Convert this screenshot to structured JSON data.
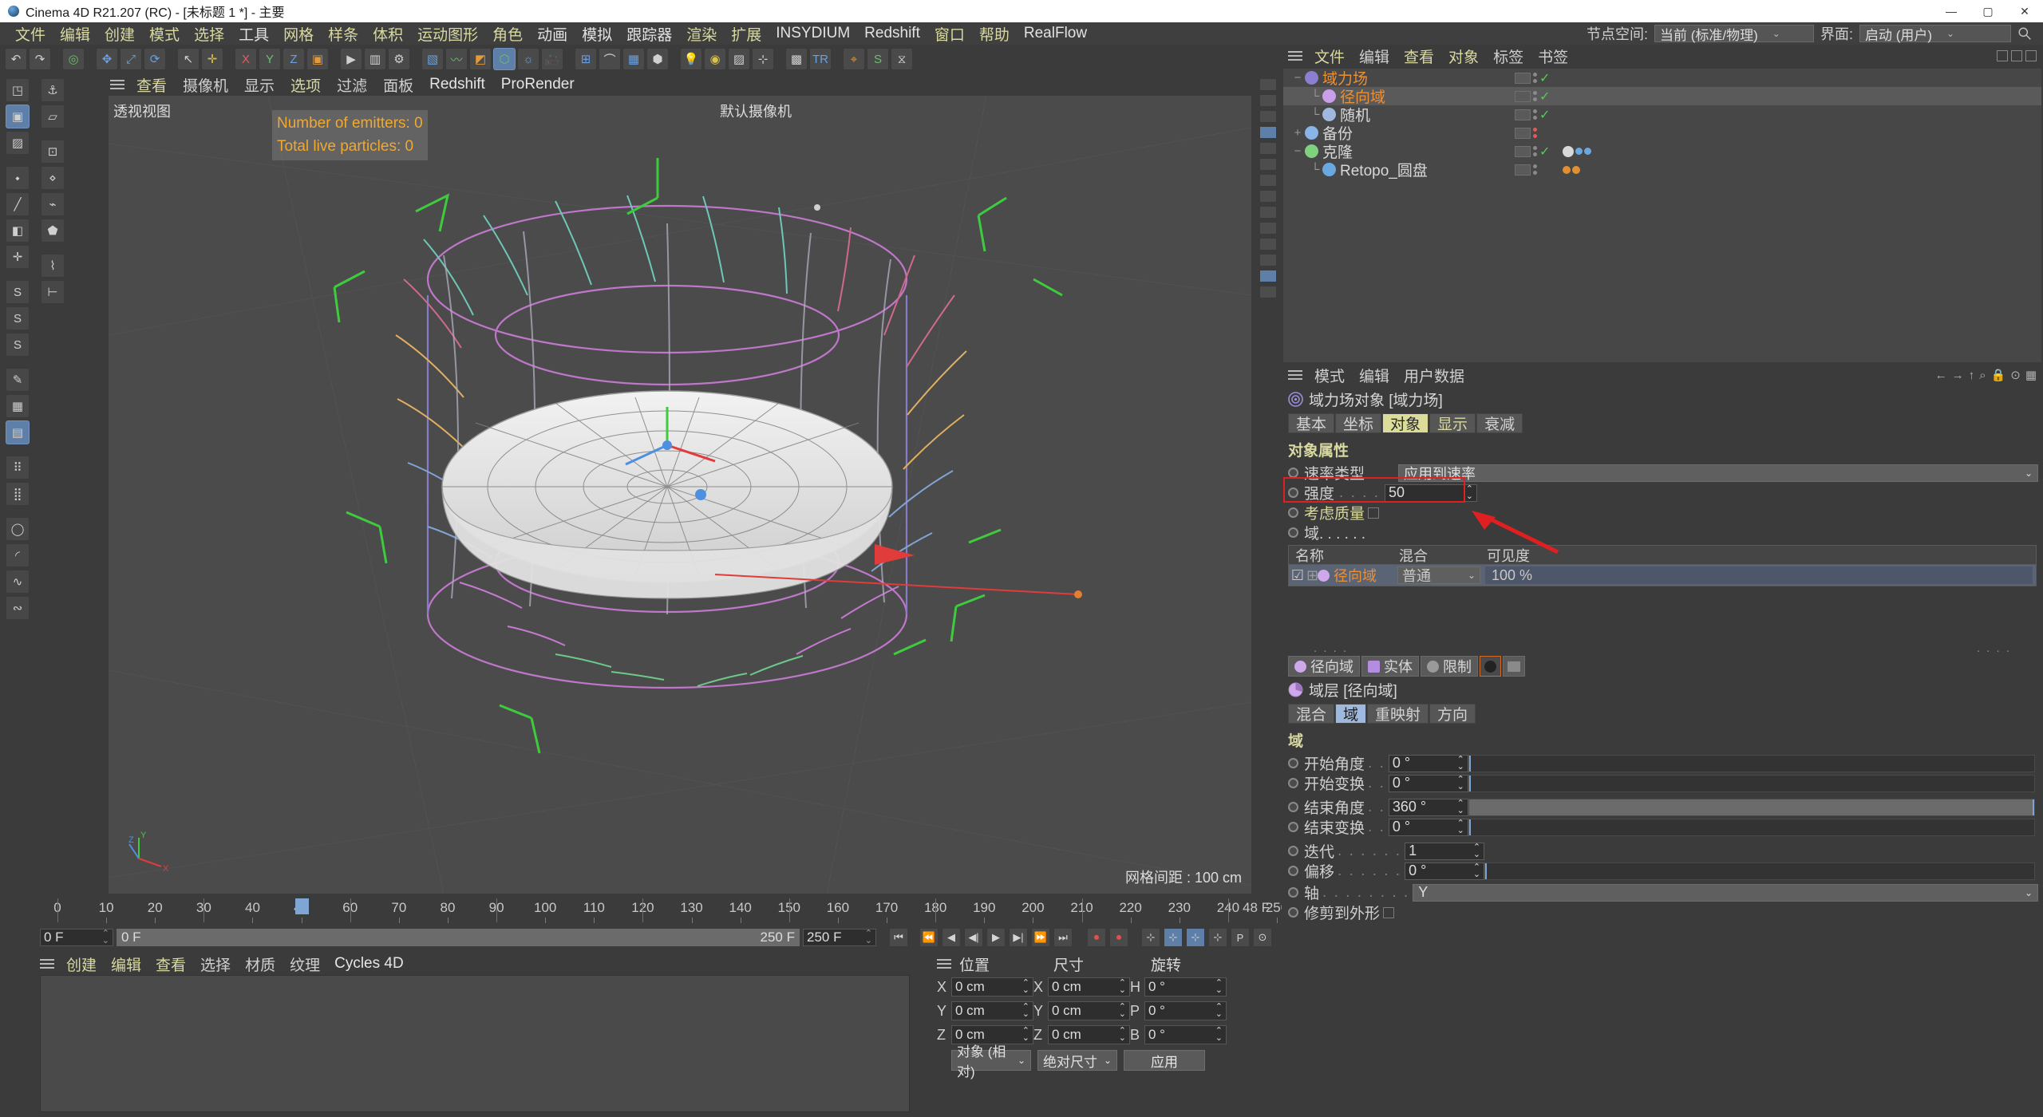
{
  "window": {
    "title": "Cinema 4D R21.207 (RC) - [未标题 1 *] - 主要",
    "min": "—",
    "max": "▢",
    "close": "✕"
  },
  "menubar": {
    "items": [
      {
        "label": "文件",
        "color": "y"
      },
      {
        "label": "编辑",
        "color": "y"
      },
      {
        "label": "创建",
        "color": "y"
      },
      {
        "label": "模式",
        "color": "y"
      },
      {
        "label": "选择",
        "color": "y"
      },
      {
        "label": "工具",
        "color": "w"
      },
      {
        "label": "网格",
        "color": "y"
      },
      {
        "label": "样条",
        "color": "y"
      },
      {
        "label": "体积",
        "color": "y"
      },
      {
        "label": "运动图形",
        "color": "y"
      },
      {
        "label": "角色",
        "color": "y"
      },
      {
        "label": "动画",
        "color": "w"
      },
      {
        "label": "模拟",
        "color": "w"
      },
      {
        "label": "跟踪器",
        "color": "w"
      },
      {
        "label": "渲染",
        "color": "y"
      },
      {
        "label": "扩展",
        "color": "y"
      },
      {
        "label": "INSYDIUM",
        "color": "w"
      },
      {
        "label": "Redshift",
        "color": "w"
      },
      {
        "label": "窗口",
        "color": "y"
      },
      {
        "label": "帮助",
        "color": "y"
      },
      {
        "label": "RealFlow",
        "color": "w"
      }
    ]
  },
  "nodespace": {
    "label": "节点空间:",
    "value": "当前 (标准/物理)",
    "layout_label": "界面:",
    "layout_value": "启动 (用户)",
    "caret": "⌄",
    "search_icon": "search-icon"
  },
  "viewport": {
    "menu": [
      "查看",
      "摄像机",
      "显示",
      "选项",
      "过滤",
      "面板",
      "Redshift",
      "ProRender"
    ],
    "view_name": "透视视图",
    "camera_name": "默认摄像机",
    "overlay": [
      "Number of emitters: 0",
      "Total live particles: 0"
    ],
    "grid_info": "网格间距 : 100 cm",
    "axis": {
      "x": "X",
      "y": "Y",
      "z": "Z"
    }
  },
  "timeline": {
    "labels": [
      "0",
      "10",
      "20",
      "30",
      "40",
      "48",
      "60",
      "70",
      "80",
      "90",
      "100",
      "110",
      "120",
      "130",
      "140",
      "150",
      "160",
      "170",
      "180",
      "190",
      "200",
      "210",
      "220",
      "230",
      "240",
      "250"
    ],
    "current_frame": "48",
    "current_frame_field": "48 F",
    "start_field": "0 F",
    "range_start": "0 F",
    "range_end": "250 F",
    "end_field": "250 F"
  },
  "material_manager": {
    "menu": [
      "创建",
      "编辑",
      "查看",
      "选择",
      "材质",
      "纹理",
      "Cycles 4D"
    ]
  },
  "coordinates": {
    "headers": [
      "位置",
      "尺寸",
      "旋转"
    ],
    "rows": [
      {
        "pax": "X",
        "pval": "0 cm",
        "sax": "X",
        "sval": "0 cm",
        "rax": "H",
        "rval": "0 °"
      },
      {
        "pax": "Y",
        "pval": "0 cm",
        "sax": "Y",
        "sval": "0 cm",
        "rax": "P",
        "rval": "0 °"
      },
      {
        "pax": "Z",
        "pval": "0 cm",
        "sax": "Z",
        "sval": "0 cm",
        "rax": "B",
        "rval": "0 °"
      }
    ],
    "mode_dropdown": "对象 (相对)",
    "size_dropdown": "绝对尺寸",
    "apply_button": "应用"
  },
  "object_manager": {
    "menu": [
      "文件",
      "编辑",
      "查看",
      "对象",
      "标签",
      "书签"
    ],
    "rows": [
      {
        "name": "域力场",
        "depth": 0,
        "expander": "−",
        "icon_color": "#8a7fd0",
        "name_color": "orange",
        "dots": "gray",
        "check": "✓",
        "selected": false
      },
      {
        "name": "径向域",
        "depth": 1,
        "expander": "",
        "icon_color": "#c89fe8",
        "name_color": "orange",
        "dots": "gray",
        "check": "✓",
        "selected": true
      },
      {
        "name": "随机",
        "depth": 1,
        "expander": "",
        "icon_color": "#9fb8e0",
        "name_color": "white",
        "dots": "gray",
        "check": "✓",
        "selected": false
      },
      {
        "name": "备份",
        "depth": 0,
        "expander": "+",
        "icon_color": "#88b4e8",
        "name_color": "white",
        "dots": "red",
        "check": "",
        "selected": false
      },
      {
        "name": "克隆",
        "depth": 0,
        "expander": "−",
        "icon_color": "#7fd07f",
        "name_color": "white",
        "dots": "gray",
        "check": "✓",
        "selected": false
      },
      {
        "name": "Retopo_圆盘",
        "depth": 1,
        "expander": "",
        "icon_color": "#6aa8e0",
        "name_color": "white",
        "dots": "gray",
        "check": "",
        "selected": false
      }
    ]
  },
  "attribute_manager": {
    "menu": [
      "模式",
      "编辑",
      "用户数据"
    ],
    "object_title": "域力场对象 [域力场]",
    "tabs": [
      {
        "label": "基本",
        "active": false,
        "color": "n"
      },
      {
        "label": "坐标",
        "active": false,
        "color": "n"
      },
      {
        "label": "对象",
        "active": true,
        "color": "n"
      },
      {
        "label": "显示",
        "active": false,
        "color": "y"
      },
      {
        "label": "衰减",
        "active": false,
        "color": "n"
      }
    ],
    "section_title": "对象属性",
    "velocity_type": {
      "label": "速率类型",
      "value": "应用到速率"
    },
    "strength": {
      "label": "强度",
      "dots": ". . . .",
      "value": "50"
    },
    "consider_mass": {
      "label": "考虑质量",
      "checked": false
    },
    "fields_label": "域. . . . . .",
    "fields_table": {
      "headers": [
        "名称",
        "混合",
        "可见度"
      ],
      "rows": [
        {
          "checked": true,
          "name": "径向域",
          "blend": "普通",
          "visibility": "100 %"
        }
      ]
    }
  },
  "field_layer_panel": {
    "chips": [
      {
        "label": "径向域",
        "icon": "radial-field-icon"
      },
      {
        "label": "实体",
        "icon": "solid-icon"
      },
      {
        "label": "限制",
        "icon": "clamp-icon"
      }
    ],
    "add_field_icon": "add-field-icon",
    "add_folder_icon": "add-folder-icon",
    "title": "域层 [径向域]",
    "tabs": [
      {
        "label": "混合",
        "active": false
      },
      {
        "label": "域",
        "active": true
      },
      {
        "label": "重映射",
        "active": false
      },
      {
        "label": "方向",
        "active": false
      }
    ],
    "section_title": "域",
    "params": [
      {
        "label": "开始角度",
        "dots": ". .",
        "value": "0 °",
        "slider": 0
      },
      {
        "label": "开始变换",
        "dots": ". .",
        "value": "0 °",
        "slider": 0
      },
      {
        "label": "结束角度",
        "dots": ". .",
        "value": "360 °",
        "slider": 100
      },
      {
        "label": "结束变换",
        "dots": ". .",
        "value": "0 °",
        "slider": 0
      },
      {
        "label": "迭代",
        "dots": ". . . . . .",
        "value": "1",
        "slider": null
      },
      {
        "label": "偏移",
        "dots": ". . . . . .",
        "value": "0 °",
        "slider": 0
      }
    ],
    "axis": {
      "label": "轴",
      "dots": ". . . . . . . .",
      "value": "Y"
    },
    "clip_to_shape": {
      "label": "修剪到外形",
      "checked": false
    }
  },
  "colors": {
    "accent_blue": "#5d7fa8",
    "highlight_yellow": "#dcdc9a",
    "field_orange": "#e8903a",
    "annotation_red": "#e02020",
    "overlay_orange": "#f0a830"
  }
}
